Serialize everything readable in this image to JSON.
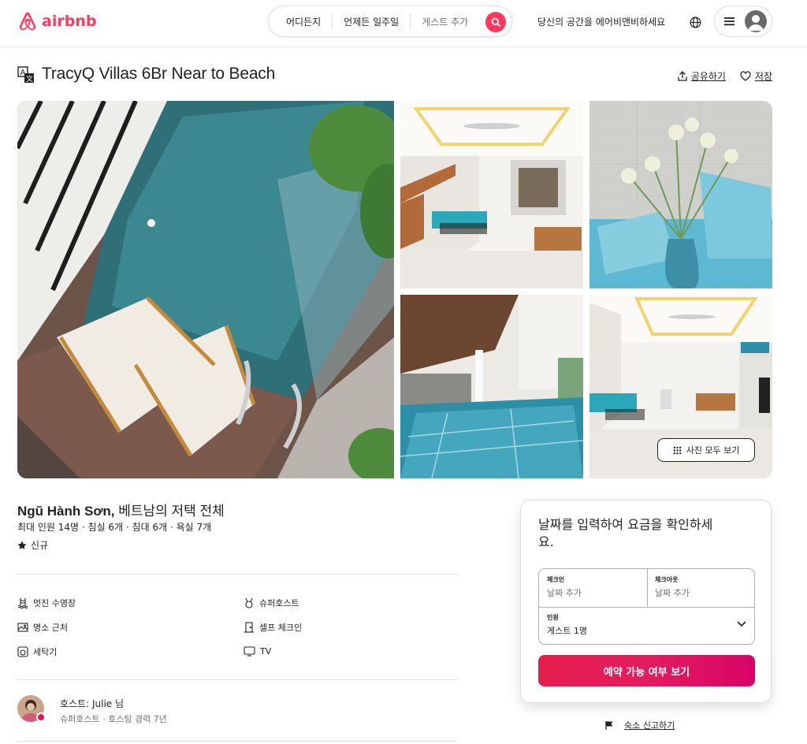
{
  "brand": {
    "name": "airbnb",
    "color": "#ff385c"
  },
  "search": {
    "where": "어디든지",
    "when": "언제든 일주일",
    "guests": "게스트 추가"
  },
  "header": {
    "host_link": "당신의 공간을 에어비앤비하세요"
  },
  "listing": {
    "title": "TracyQ Villas 6Br Near to Beach",
    "share": "공유하기",
    "save": "저장",
    "show_all_photos": "사진 모두 보기",
    "location_bold": "Ngũ Hành Sơn,",
    "location_rest": " 베트남의 저택 전체",
    "summary": "최대 인원 14명 · 침실 6개 · 침대 6개 · 욕실 7개",
    "rating": "신규"
  },
  "amenities": [
    {
      "icon": "pool-icon",
      "label": "멋진 수영장"
    },
    {
      "icon": "medal-icon",
      "label": "슈퍼호스트"
    },
    {
      "icon": "picture-icon",
      "label": "명소 근처"
    },
    {
      "icon": "door-icon",
      "label": "셀프 체크인"
    },
    {
      "icon": "washer-icon",
      "label": "세탁기"
    },
    {
      "icon": "tv-icon",
      "label": "TV"
    }
  ],
  "host": {
    "name": "호스트: Julie 님",
    "detail": "슈퍼호스트 · 호스팅 경력 7년"
  },
  "booking": {
    "prompt": "날짜를 입력하여 요금을 확인하세요.",
    "checkin_label": "체크인",
    "checkin_value": "날짜 추가",
    "checkout_label": "체크아웃",
    "checkout_value": "날짜 추가",
    "guests_label": "인원",
    "guests_value": "게스트 1명",
    "cta": "예약 가능 여부 보기"
  },
  "report": "숙소 신고하기"
}
